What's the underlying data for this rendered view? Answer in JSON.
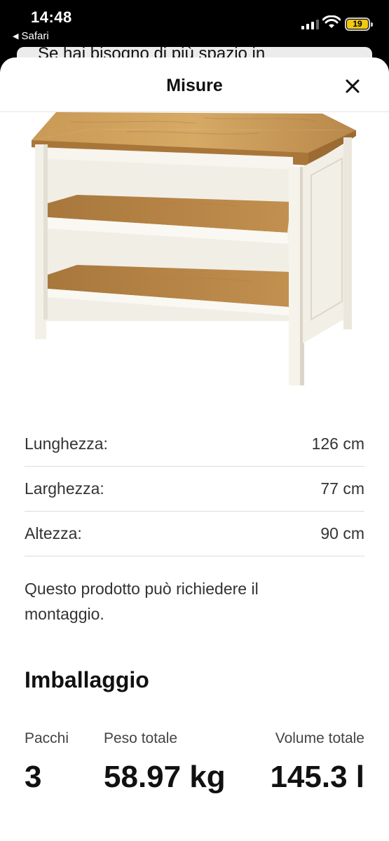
{
  "status_bar": {
    "time": "14:48",
    "back_app": "Safari",
    "battery": "19",
    "battery_color": "#f2c811"
  },
  "background_page": {
    "text": "Se hai bisogno di più spazio in"
  },
  "sheet": {
    "title": "Misure",
    "close_icon": "close-icon",
    "product_image": "kitchen-island-image",
    "dimensions": [
      {
        "label": "Lunghezza:",
        "value": "126 cm"
      },
      {
        "label": "Larghezza:",
        "value": "77 cm"
      },
      {
        "label": "Altezza:",
        "value": "90 cm"
      }
    ],
    "note": "Questo prodotto può richiedere il montaggio.",
    "packaging": {
      "title": "Imballaggio",
      "columns": [
        {
          "label": "Pacchi",
          "value": "3"
        },
        {
          "label": "Peso totale",
          "value": "58.97 kg"
        },
        {
          "label": "Volume totale",
          "value": "145.3 l"
        }
      ]
    }
  }
}
